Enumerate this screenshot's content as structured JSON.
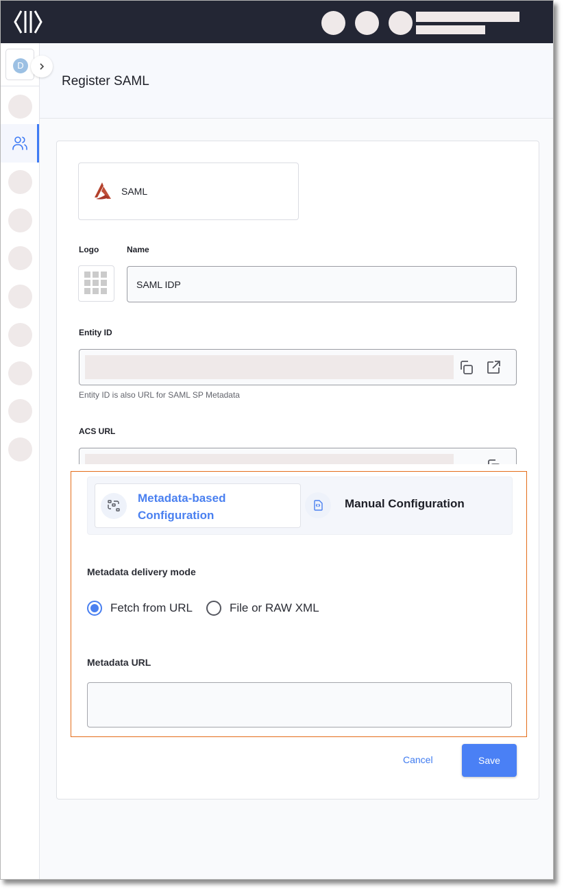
{
  "app": {
    "logo_icon": "brackets-logo-icon",
    "topbar_redacted": true
  },
  "sidebar": {
    "org_avatar_initial": "D",
    "expand_icon": "chevron-right-icon",
    "items": [
      {
        "name": "sidebar-item-1",
        "icon": "placeholder-circle",
        "active": false
      },
      {
        "name": "sidebar-item-users",
        "icon": "users-icon",
        "active": true
      },
      {
        "name": "sidebar-item-3",
        "icon": "placeholder-circle",
        "active": false
      },
      {
        "name": "sidebar-item-4",
        "icon": "placeholder-circle",
        "active": false
      },
      {
        "name": "sidebar-item-5",
        "icon": "placeholder-circle",
        "active": false
      },
      {
        "name": "sidebar-item-6",
        "icon": "placeholder-circle",
        "active": false
      },
      {
        "name": "sidebar-item-7",
        "icon": "placeholder-circle",
        "active": false
      },
      {
        "name": "sidebar-item-8",
        "icon": "placeholder-circle",
        "active": false
      },
      {
        "name": "sidebar-item-9",
        "icon": "placeholder-circle",
        "active": false
      },
      {
        "name": "sidebar-item-10",
        "icon": "placeholder-circle",
        "active": false
      }
    ]
  },
  "header": {
    "title": "Register SAML"
  },
  "form": {
    "provider": {
      "name": "SAML",
      "icon": "saml-logo-icon"
    },
    "logo_label": "Logo",
    "logo_icon": "grid-placeholder-icon",
    "name_label": "Name",
    "name_value": "SAML IDP",
    "entity_id_label": "Entity ID",
    "entity_id_helper": "Entity ID is also URL for SAML SP Metadata",
    "acs_url_label": "ACS URL",
    "copy_icon": "copy-icon",
    "open_icon": "external-link-icon"
  },
  "config": {
    "tabs": [
      {
        "label": "Metadata-based Configuration",
        "line1": "Metadata-based",
        "line2": "Configuration",
        "icon": "metadata-scan-icon",
        "selected": true
      },
      {
        "label": "Manual Configuration",
        "icon": "code-file-icon",
        "selected": false
      }
    ],
    "delivery_mode_label": "Metadata delivery mode",
    "delivery_options": [
      {
        "label": "Fetch from URL",
        "checked": true
      },
      {
        "label": "File or RAW XML",
        "checked": false
      }
    ],
    "metadata_url_label": "Metadata URL",
    "metadata_url_value": ""
  },
  "actions": {
    "cancel_label": "Cancel",
    "save_label": "Save"
  },
  "colors": {
    "accent": "#4a80f5",
    "topbar": "#232634",
    "highlight_border": "#e46c17",
    "saml_brand": "#b3412c"
  }
}
